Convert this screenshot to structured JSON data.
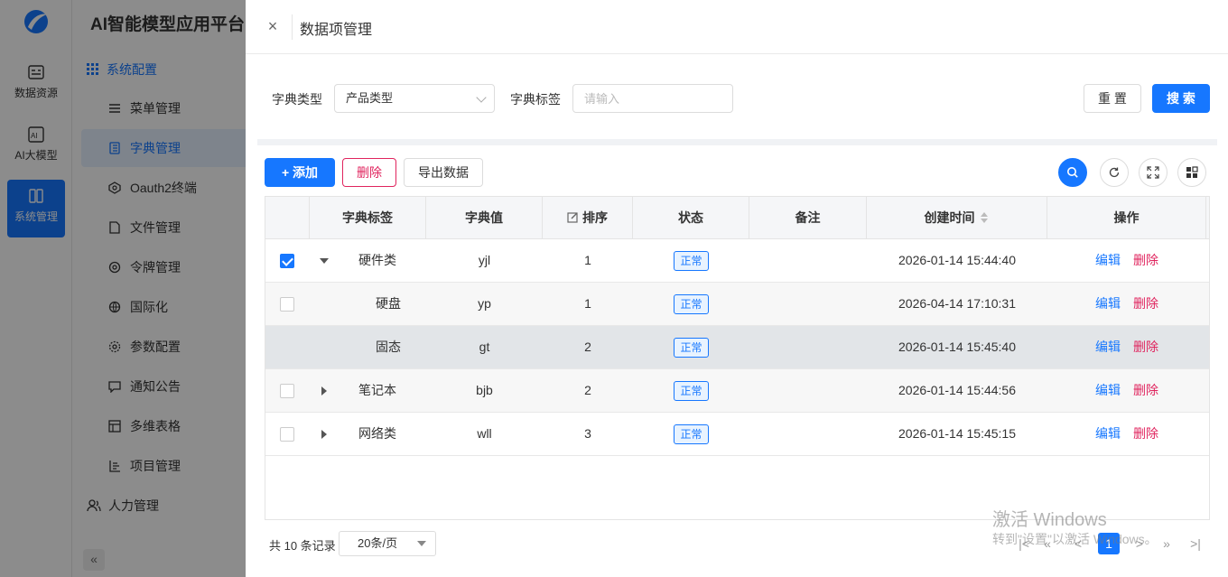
{
  "app": {
    "brand": "AI智能模型应用平台",
    "rail": [
      {
        "label": "数据资源",
        "icon": "database-icon"
      },
      {
        "label": "AI大模型",
        "icon": "ai-model-icon"
      },
      {
        "label": "系统管理",
        "icon": "system-icon",
        "active": true
      }
    ],
    "section": "系统配置",
    "menu": [
      {
        "label": "菜单管理",
        "icon": "menu-list-icon"
      },
      {
        "label": "字典管理",
        "icon": "dictionary-icon",
        "active": true
      },
      {
        "label": "Oauth2终端",
        "icon": "oauth-icon"
      },
      {
        "label": "文件管理",
        "icon": "file-icon"
      },
      {
        "label": "令牌管理",
        "icon": "token-icon"
      },
      {
        "label": "国际化",
        "icon": "globe-icon"
      },
      {
        "label": "参数配置",
        "icon": "params-icon"
      },
      {
        "label": "通知公告",
        "icon": "notice-icon"
      },
      {
        "label": "多维表格",
        "icon": "table-icon"
      },
      {
        "label": "项目管理",
        "icon": "project-icon"
      }
    ],
    "footer_menu": "人力管理",
    "collapse_glyph": "«"
  },
  "drawer": {
    "title": "数据项管理",
    "close_glyph": "×"
  },
  "filters": {
    "type_label": "字典类型",
    "type_value": "产品类型",
    "tag_label": "字典标签",
    "tag_placeholder": "请输入",
    "reset": "重 置",
    "search": "搜 索"
  },
  "toolbar": {
    "add": "+ 添加",
    "delete": "删除",
    "export": "导出数据"
  },
  "table": {
    "columns": [
      "字典标签",
      "字典值",
      "排序",
      "状态",
      "备注",
      "创建时间",
      "操作"
    ],
    "edit_label": "编辑",
    "delete_label": "删除",
    "rows": [
      {
        "label": "硬件类",
        "value": "yjl",
        "sort": "1",
        "status": "正常",
        "remark": "",
        "created": "2026-01-14 15:44:40",
        "checked": true,
        "expand": "open",
        "style": "",
        "checkbox": true
      },
      {
        "label": "硬盘",
        "value": "yp",
        "sort": "1",
        "status": "正常",
        "remark": "",
        "created": "2026-04-14 17:10:31",
        "checked": false,
        "expand": "none",
        "style": "alt",
        "checkbox": true
      },
      {
        "label": "固态",
        "value": "gt",
        "sort": "2",
        "status": "正常",
        "remark": "",
        "created": "2026-01-14 15:45:40",
        "checked": false,
        "expand": "none",
        "style": "hl",
        "checkbox": false
      },
      {
        "label": "笔记本",
        "value": "bjb",
        "sort": "2",
        "status": "正常",
        "remark": "",
        "created": "2026-01-14 15:44:56",
        "checked": false,
        "expand": "closed",
        "style": "alt",
        "checkbox": true
      },
      {
        "label": "网络类",
        "value": "wll",
        "sort": "3",
        "status": "正常",
        "remark": "",
        "created": "2026-01-14 15:45:15",
        "checked": false,
        "expand": "closed",
        "style": "",
        "checkbox": true
      }
    ]
  },
  "pagination": {
    "total_text": "共 10 条记录",
    "page_size": "20条/页",
    "current_page": "1",
    "nav_glyphs": [
      "|<",
      "«",
      "<",
      ">",
      "»",
      ">|"
    ]
  },
  "watermark": {
    "line1": "激活 Windows",
    "line2": "转到\"设置\"以激活 Windows。"
  }
}
